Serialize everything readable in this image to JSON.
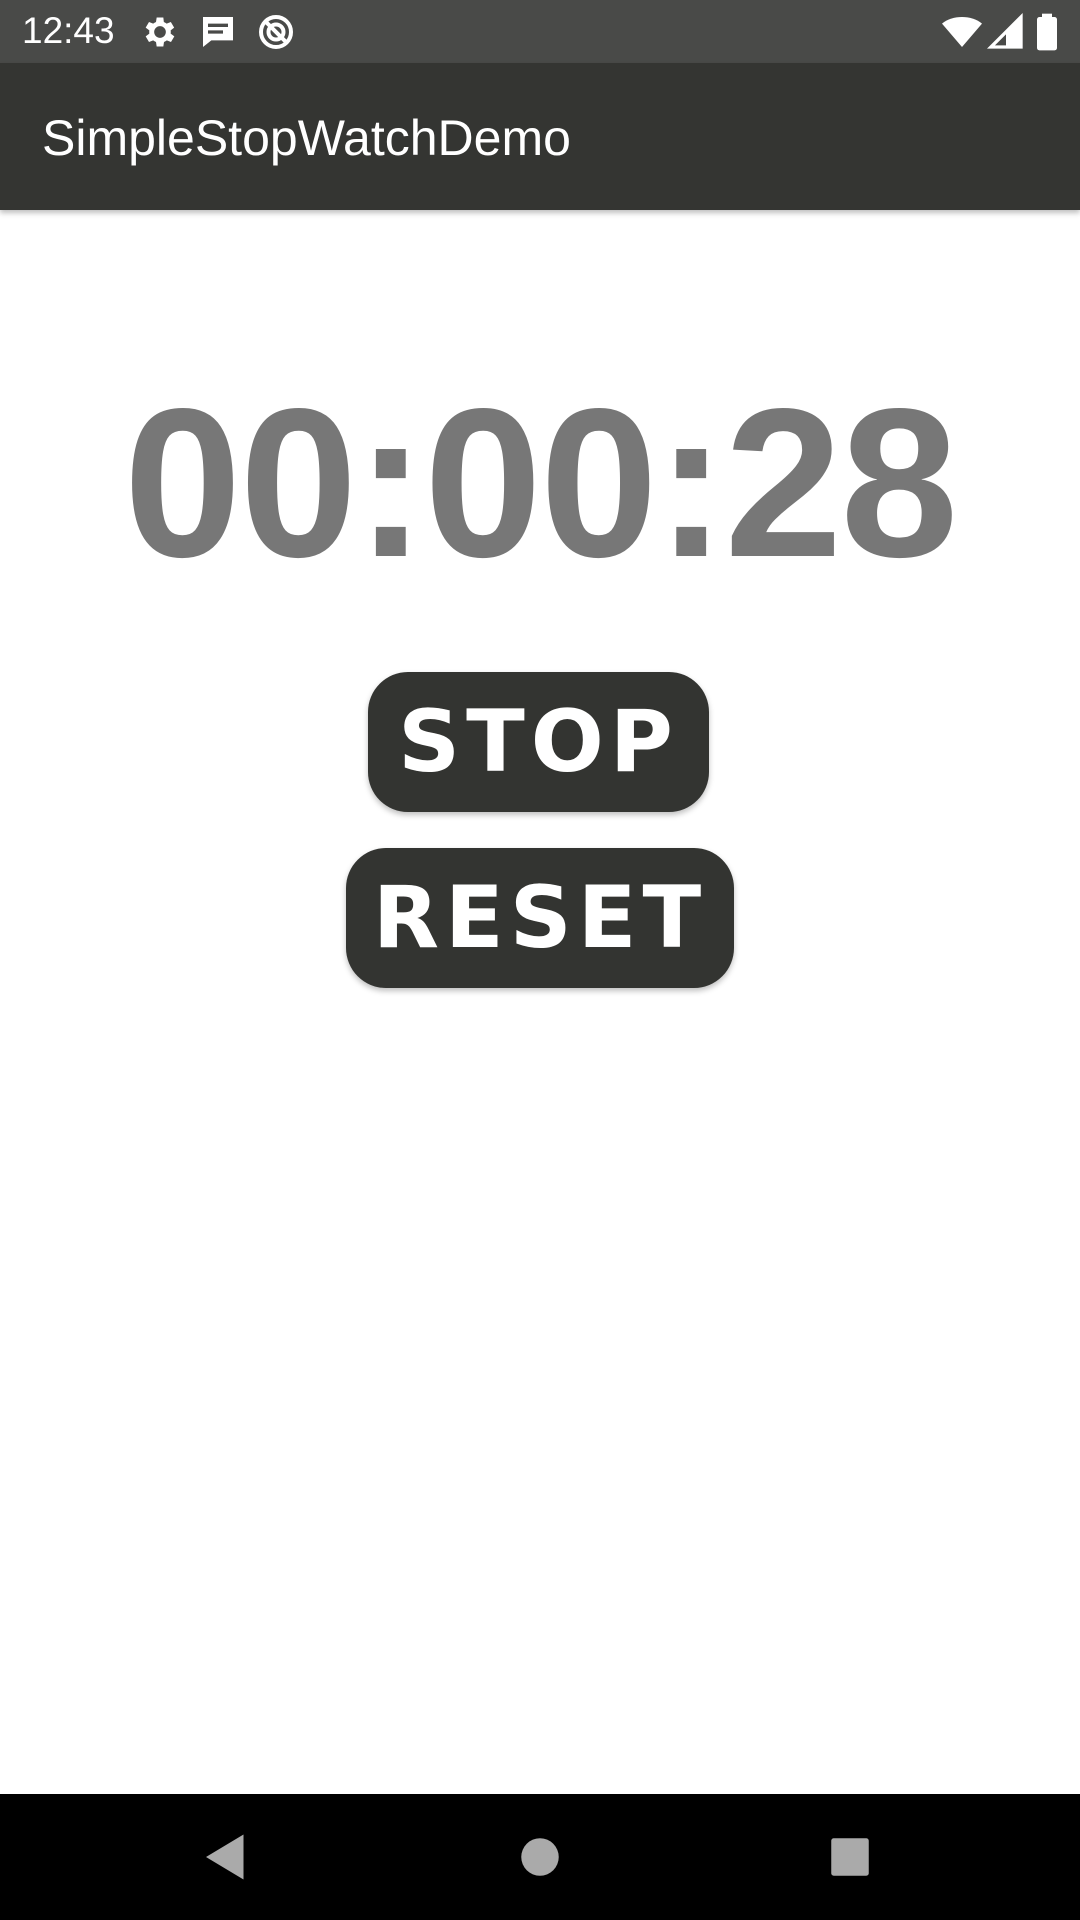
{
  "status_bar": {
    "time": "12:43",
    "icons": [
      "gear-icon",
      "message-icon",
      "no-sync-icon",
      "wifi-icon",
      "signal-icon",
      "battery-icon"
    ]
  },
  "app_bar": {
    "title": "SimpleStopWatchDemo"
  },
  "main": {
    "timer_value": "00:00:28",
    "stop_label": "STOP",
    "reset_label": "RESET"
  },
  "nav_bar": {
    "icons": [
      "back-icon",
      "home-icon",
      "recents-icon"
    ]
  },
  "colors": {
    "status_bar": "#494a48",
    "app_bar": "#343532",
    "button": "#333431",
    "timer_text": "#777777",
    "nav_bar": "#000000"
  }
}
